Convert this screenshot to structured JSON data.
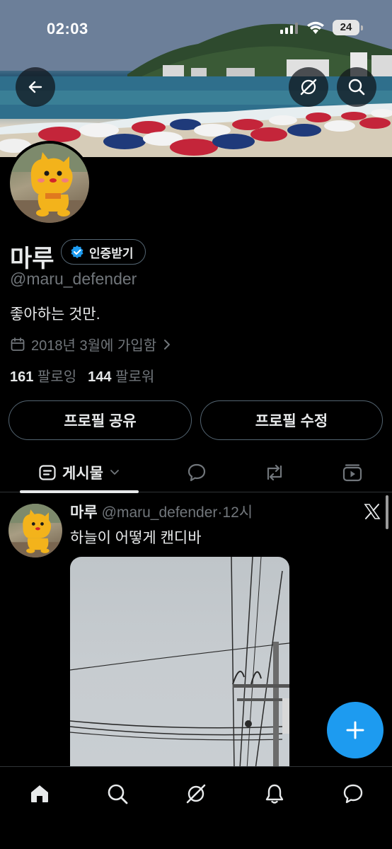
{
  "status_bar": {
    "time": "02:03",
    "battery": "24"
  },
  "profile": {
    "name": "마루",
    "verify_label": "인증받기",
    "handle": "@maru_defender",
    "bio": "좋아하는 것만.",
    "joined": "2018년 3월에 가입함",
    "following_count": "161",
    "following_label": "팔로잉",
    "followers_count": "144",
    "followers_label": "팔로워",
    "share_label": "프로필 공유",
    "edit_label": "프로필 수정"
  },
  "tabs": {
    "posts_label": "게시물"
  },
  "post": {
    "name": "마루",
    "handle": "@maru_defender",
    "time": "·12시",
    "text": "하늘이 어떻게 캔디바"
  },
  "icons": {
    "back": "arrow-left-icon",
    "grok": "grok-icon",
    "search": "search-icon",
    "verified": "verified-badge-icon",
    "calendar": "calendar-icon",
    "chevron": "chevron-right-icon",
    "posts_tab": "posts-icon",
    "replies_tab": "speech-bubble-icon",
    "reposts_tab": "repost-icon",
    "media_tab": "media-icon",
    "x_logo": "x-logo-icon",
    "compose": "plus-icon",
    "home": "home-icon",
    "notifications": "bell-icon",
    "messages": "message-icon"
  },
  "colors": {
    "accent": "#1d9bf0",
    "background": "#000000",
    "text": "#e7e9ea",
    "muted": "#71767b",
    "border": "#536471"
  }
}
